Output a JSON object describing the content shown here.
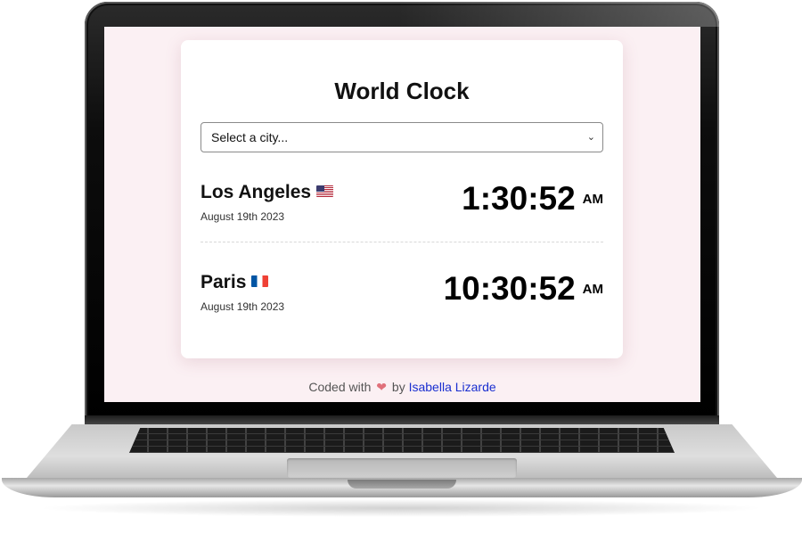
{
  "app": {
    "title": "World Clock",
    "accent_background": "#fbf0f3"
  },
  "city_select": {
    "selected": "Select a city...",
    "chevron_icon": "chevron-down-icon"
  },
  "cities": [
    {
      "name": "Los Angeles",
      "flag_icon": "us-flag-icon",
      "date": "August 19th 2023",
      "time": "1:30:52",
      "period": "AM"
    },
    {
      "name": "Paris",
      "flag_icon": "france-flag-icon",
      "date": "August 19th 2023",
      "time": "10:30:52",
      "period": "AM"
    }
  ],
  "footer": {
    "prefix": "Coded with",
    "heart_icon": "heart-icon",
    "heart_glyph": "❤",
    "by": "by",
    "author": "Isabella Lizarde",
    "link_color": "#1a2fd0"
  }
}
